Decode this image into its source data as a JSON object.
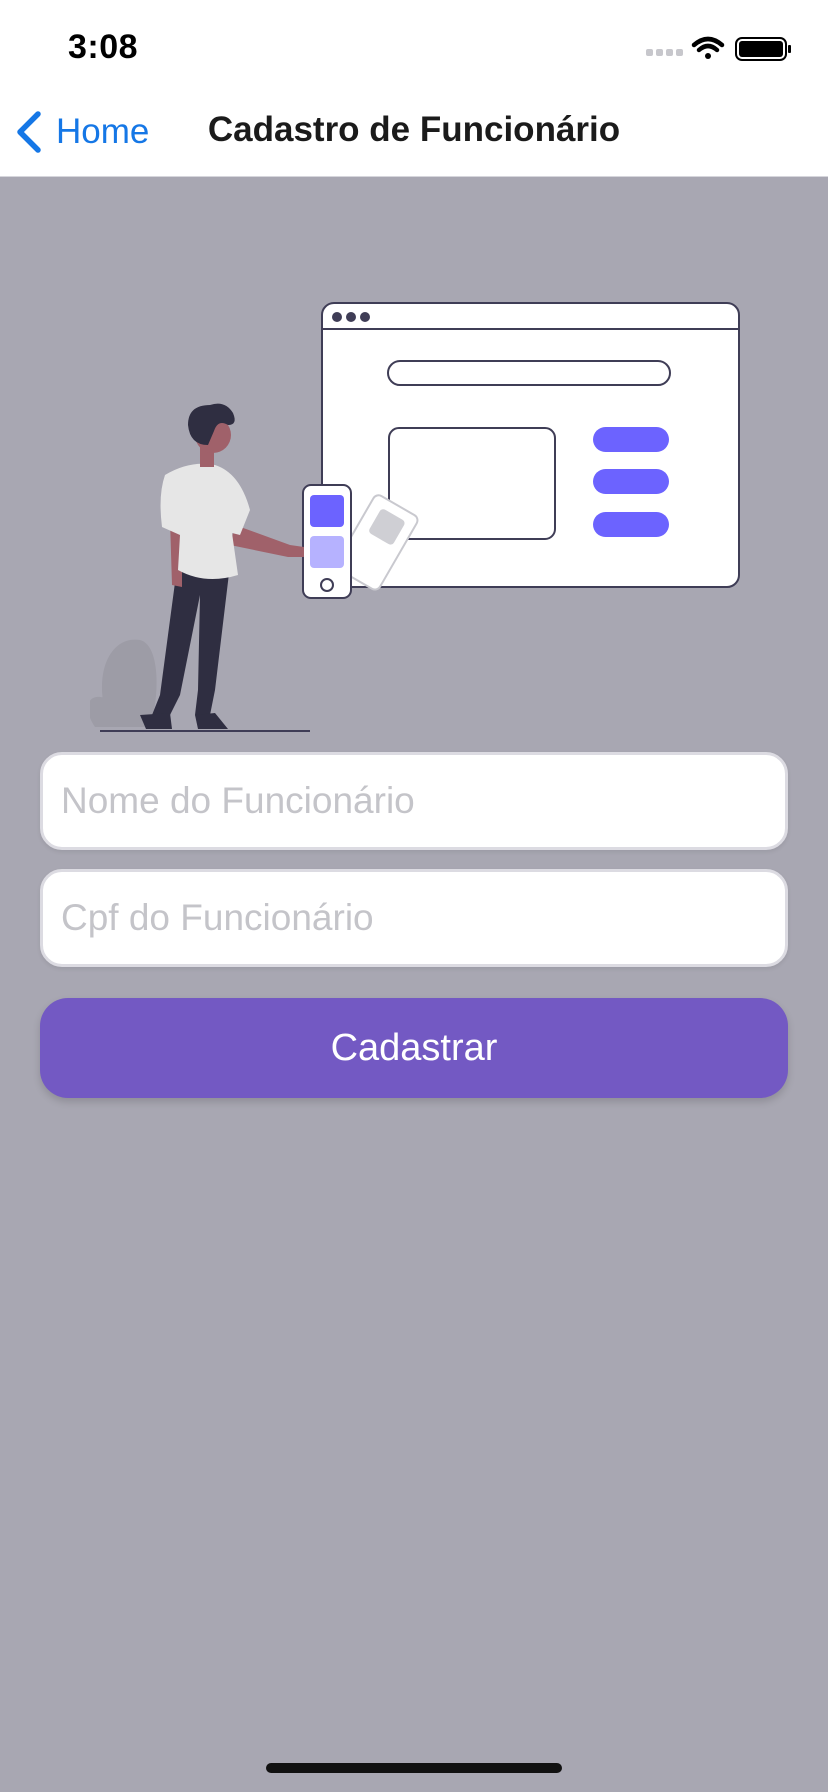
{
  "status_bar": {
    "time": "3:08"
  },
  "nav": {
    "back_label": "Home",
    "title": "Cadastro de Funcionário"
  },
  "form": {
    "name_placeholder": "Nome do Funcionário",
    "name_value": "",
    "cpf_placeholder": "Cpf do Funcionário",
    "cpf_value": "",
    "submit_label": "Cadastrar"
  },
  "colors": {
    "background": "#a8a7b2",
    "accent": "#7359c3",
    "link": "#1577e6",
    "illustration_accent": "#6c63ff"
  },
  "icons": [
    "chevron-left-icon",
    "wifi-icon",
    "battery-icon",
    "signal-icon"
  ]
}
